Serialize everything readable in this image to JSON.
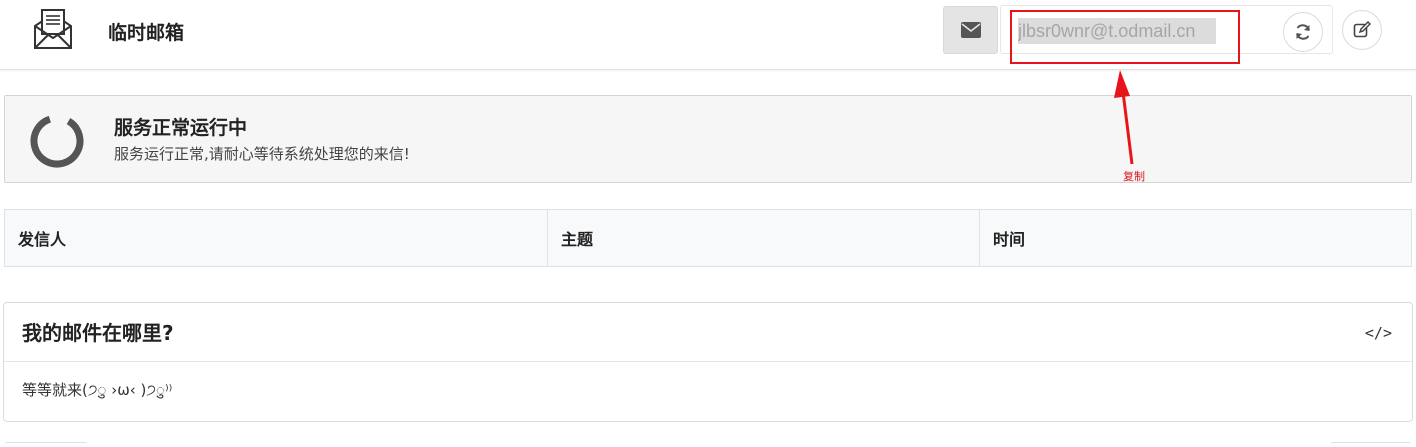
{
  "header": {
    "title": "临时邮箱",
    "logo_icon": "envelope-letter-icon",
    "mail_button_icon": "envelope-icon",
    "email_value": "jlbsr0wnr@t.odmail.cn",
    "refresh_icon": "refresh-icon",
    "edit_icon": "edit-icon"
  },
  "status": {
    "icon": "loading-spinner-icon",
    "title": "服务正常运行中",
    "description": "服务运行正常,请耐心等待系统处理您的来信!"
  },
  "annotation": {
    "note": "复制",
    "color": "#e8141b"
  },
  "table": {
    "columns": [
      "发信人",
      "主题",
      "时间"
    ]
  },
  "card": {
    "title": "我的邮件在哪里?",
    "code_icon_label": "</>",
    "body": "等等就来(੭ु ›ω‹ )੭ु⁾⁾"
  }
}
